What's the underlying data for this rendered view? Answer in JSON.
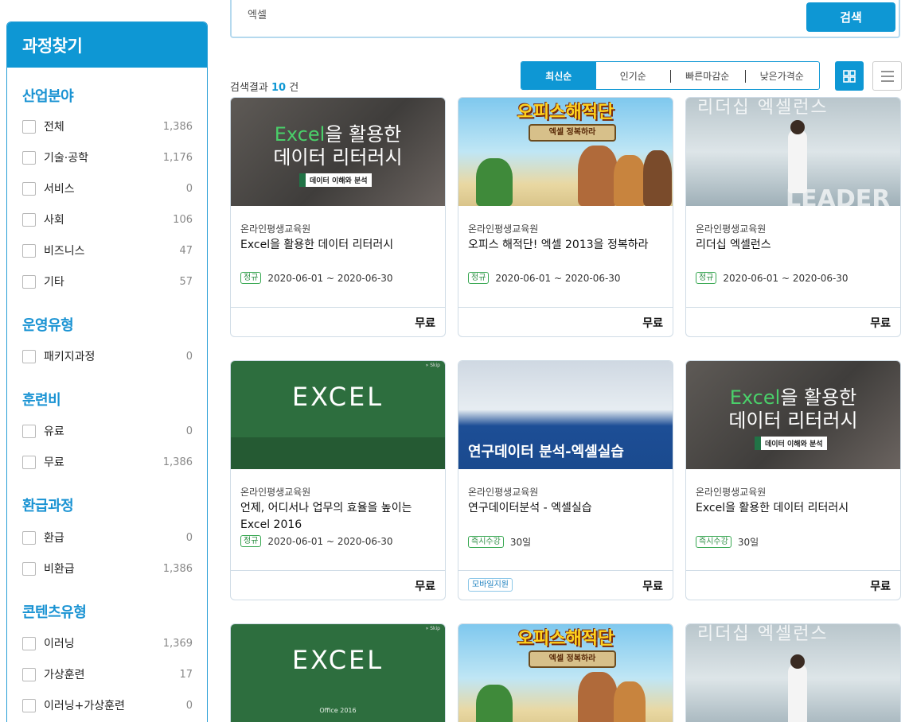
{
  "search": {
    "value": "엑셀",
    "button_label": "검색"
  },
  "sidebar": {
    "title": "과정찾기",
    "groups": [
      {
        "title": "산업분야",
        "items": [
          {
            "label": "전체",
            "count": "1,386"
          },
          {
            "label": "기술·공학",
            "count": "1,176"
          },
          {
            "label": "서비스",
            "count": "0"
          },
          {
            "label": "사회",
            "count": "106"
          },
          {
            "label": "비즈니스",
            "count": "47"
          },
          {
            "label": "기타",
            "count": "57"
          }
        ]
      },
      {
        "title": "운영유형",
        "items": [
          {
            "label": "패키지과정",
            "count": "0"
          }
        ]
      },
      {
        "title": "훈련비",
        "items": [
          {
            "label": "유료",
            "count": "0"
          },
          {
            "label": "무료",
            "count": "1,386"
          }
        ]
      },
      {
        "title": "환급과정",
        "items": [
          {
            "label": "환급",
            "count": "0"
          },
          {
            "label": "비환급",
            "count": "1,386"
          }
        ]
      },
      {
        "title": "콘텐츠유형",
        "items": [
          {
            "label": "이러닝",
            "count": "1,369"
          },
          {
            "label": "가상훈련",
            "count": "17"
          },
          {
            "label": "이러닝+가상훈련",
            "count": "0"
          }
        ]
      }
    ]
  },
  "results": {
    "prefix": "검색결과",
    "count": "10",
    "suffix": "건"
  },
  "sort": {
    "options": [
      "최신순",
      "인기순",
      "빠른마감순",
      "낮은가격순"
    ],
    "active": "최신순"
  },
  "view": {
    "grid_icon": "grid-icon",
    "list_icon": "list-icon"
  },
  "thumb_text": {
    "excel_brand": "Excel",
    "excel_line1_rest": "을 활용한",
    "excel_line2": "데이터 리터러시",
    "excel_tag": "데이터 이해와 분석",
    "pirate_title": "오피스해적단",
    "pirate_banner": "엑셀 정복하라",
    "leader_title": "리더십 엑셀런스",
    "leader_big": "LEADER",
    "green_word": "EXCEL",
    "green_sub": "Office 2016",
    "green_skip": "» Skip",
    "data_title": "연구데이터 분석-엑셀실습"
  },
  "courses": [
    {
      "provider": "온라인평생교육원",
      "title": "Excel을 활용한 데이터 리터러시",
      "tag": "정규",
      "period": "2020-06-01 ~ 2020-06-30",
      "price": "무료",
      "thumb": "excel"
    },
    {
      "provider": "온라인평생교육원",
      "title": "오피스 해적단! 엑셀 2013을 정복하라",
      "tag": "정규",
      "period": "2020-06-01 ~ 2020-06-30",
      "price": "무료",
      "thumb": "pirate"
    },
    {
      "provider": "온라인평생교육원",
      "title": "리더십 엑셀런스",
      "tag": "정규",
      "period": "2020-06-01 ~ 2020-06-30",
      "price": "무료",
      "thumb": "leader"
    },
    {
      "provider": "온라인평생교육원",
      "title": "언제, 어디서나 업무의 효율을 높이는 Excel 2016",
      "tag": "정규",
      "period": "2020-06-01 ~ 2020-06-30",
      "price": "무료",
      "thumb": "green"
    },
    {
      "provider": "온라인평생교육원",
      "title": "연구데이터분석 - 엑셀실습",
      "tag": "즉시수강",
      "period": "30일",
      "price": "무료",
      "mobile": "모바일지원",
      "thumb": "data"
    },
    {
      "provider": "온라인평생교육원",
      "title": "Excel을 활용한 데이터 리터러시",
      "tag": "즉시수강",
      "period": "30일",
      "price": "무료",
      "thumb": "excel"
    }
  ]
}
